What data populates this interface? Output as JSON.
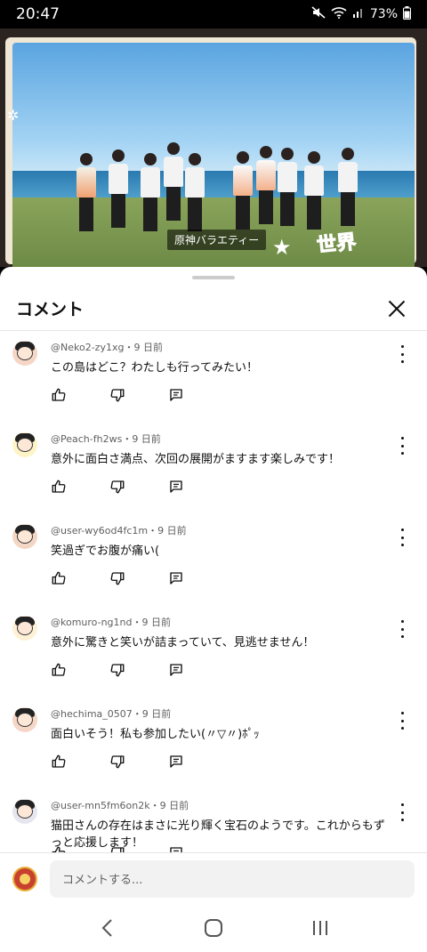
{
  "status_bar": {
    "time": "20:47",
    "battery": "73%",
    "icons": [
      "mute-icon",
      "wifi-icon",
      "signal-icon",
      "battery-icon"
    ]
  },
  "video": {
    "caption": "原神バラエティー",
    "logo": "世界"
  },
  "sheet": {
    "title": "コメント"
  },
  "comments": [
    {
      "author": "@Neko2-zy1xg",
      "time": "9 日前",
      "text": "この島はどこ？わたしも行ってみたい！",
      "avatar_color": "#f6d6c6"
    },
    {
      "author": "@Peach-fh2ws",
      "time": "9 日前",
      "text": "意外に面白さ満点、次回の展開がますます楽しみです！",
      "avatar_color": "#fff4c8"
    },
    {
      "author": "@user-wy6od4fc1m",
      "time": "9 日前",
      "text": "笑過ぎでお腹が痛い(",
      "avatar_color": "#f3d7c4"
    },
    {
      "author": "@komuro-ng1nd",
      "time": "9 日前",
      "text": "意外に驚きと笑いが詰まっていて、見逃せません！",
      "avatar_color": "#fff1d6"
    },
    {
      "author": "@hechima_0507",
      "time": "9 日前",
      "text": "面白いそう！私も参加したい(〃▽〃)ﾎﾟｯ",
      "avatar_color": "#f6d6c6"
    },
    {
      "author": "@user-mn5fm6on2k",
      "time": "9 日前",
      "text": "猫田さんの存在はまさに光り輝く宝石のようです。これからもずっと応援します！",
      "avatar_color": "#e6e6ee"
    }
  ],
  "input": {
    "placeholder": "コメントする..."
  },
  "meta_separator": "・"
}
